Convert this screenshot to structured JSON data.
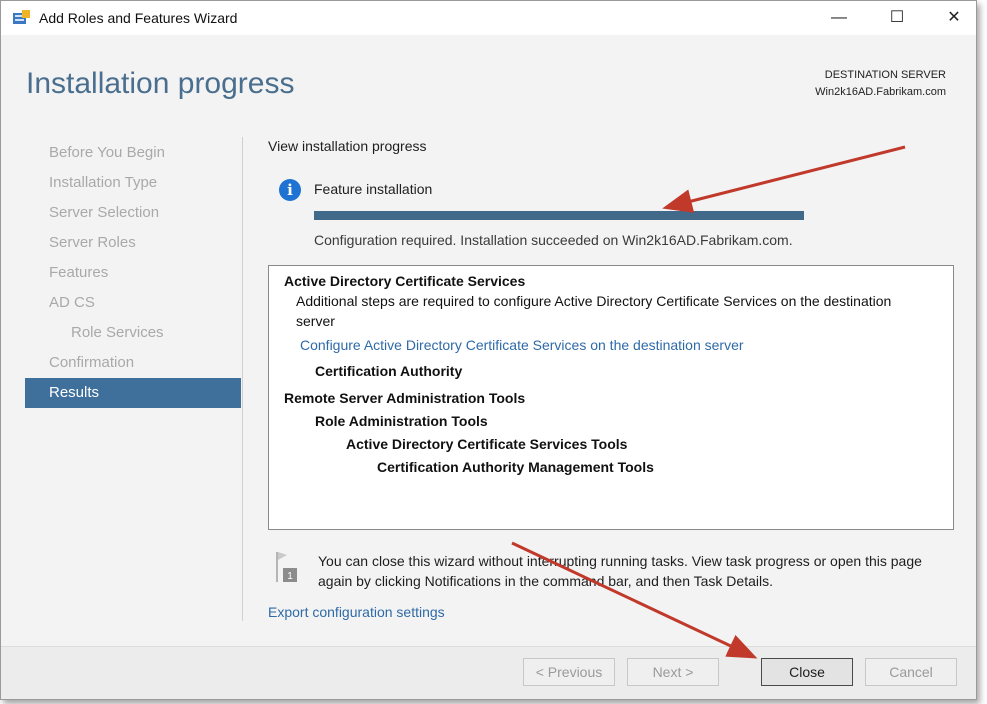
{
  "window": {
    "title": "Add Roles and Features Wizard",
    "controls": {
      "minimize": "—",
      "maximize": "☐",
      "close": "✕"
    }
  },
  "header": {
    "title": "Installation progress",
    "destination_label": "DESTINATION SERVER",
    "destination_server": "Win2k16AD.Fabrikam.com"
  },
  "nav": {
    "items": [
      {
        "label": "Before You Begin"
      },
      {
        "label": "Installation Type"
      },
      {
        "label": "Server Selection"
      },
      {
        "label": "Server Roles"
      },
      {
        "label": "Features"
      },
      {
        "label": "AD CS"
      },
      {
        "label": "Role Services"
      },
      {
        "label": "Confirmation"
      },
      {
        "label": "Results"
      }
    ],
    "active": "Results"
  },
  "main": {
    "heading": "View installation progress",
    "feature_label": "Feature installation",
    "progress_percent": 100,
    "status": "Configuration required. Installation succeeded on Win2k16AD.Fabrikam.com.",
    "results": {
      "adcs_title": "Active Directory Certificate Services",
      "adcs_note_line1": "Additional steps are required to configure Active Directory Certificate Services on the destination",
      "adcs_note_line2": "server",
      "adcs_link": "Configure Active Directory Certificate Services on the destination server",
      "cert_authority": "Certification Authority",
      "rsat_title": "Remote Server Administration Tools",
      "role_admin_tools": "Role Administration Tools",
      "adcs_tools": "Active Directory Certificate Services Tools",
      "ca_mgmt_tools": "Certification Authority Management Tools"
    },
    "notice": "You can close this wizard without interrupting running tasks. View task progress or open this page again by clicking Notifications in the command bar, and then Task Details.",
    "notice_badge": "1",
    "export_link": "Export configuration settings"
  },
  "footer": {
    "previous": "< Previous",
    "next": "Next >",
    "close": "Close",
    "cancel": "Cancel"
  },
  "colors": {
    "accent": "#3f6f9b",
    "header_text": "#4a6f8e",
    "progress": "#41698a",
    "link": "#2f6aa8",
    "annotation_arrow": "#c0392b"
  }
}
